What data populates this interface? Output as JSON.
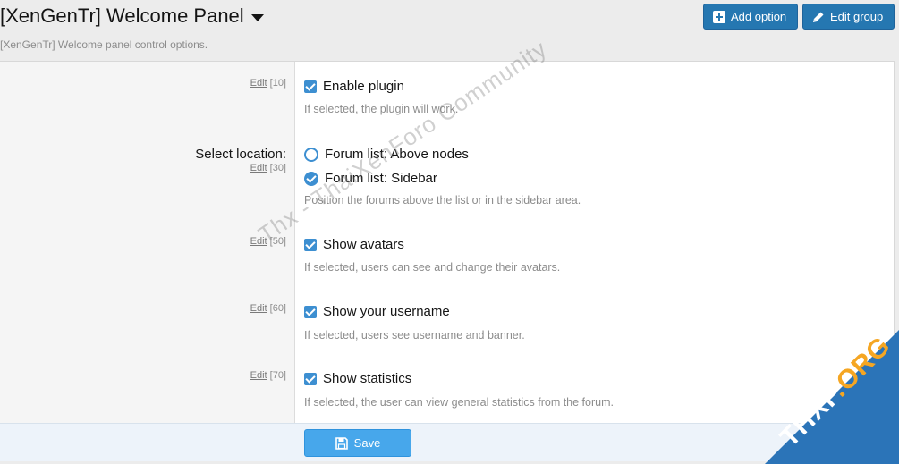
{
  "header": {
    "title": "[XenGenTr] Welcome Panel",
    "description": "[XenGenTr] Welcome panel control options."
  },
  "actions": {
    "add_option": "Add option",
    "edit_group": "Edit group"
  },
  "options": {
    "enable_plugin": {
      "edit": "Edit",
      "order": "[10]",
      "label": "Enable plugin",
      "checked": true,
      "hint": "If selected, the plugin will work."
    },
    "location": {
      "title": "Select location:",
      "edit": "Edit",
      "order": "[30]",
      "choices": [
        {
          "label": "Forum list: Above nodes",
          "selected": false
        },
        {
          "label": "Forum list: Sidebar",
          "selected": true
        }
      ],
      "hint": "Position the forums above the list or in the sidebar area."
    },
    "show_avatars": {
      "edit": "Edit",
      "order": "[50]",
      "label": "Show avatars",
      "checked": true,
      "hint": "If selected, users can see and change their avatars."
    },
    "show_username": {
      "edit": "Edit",
      "order": "[60]",
      "label": "Show your username",
      "checked": true,
      "hint": "If selected, users see username and banner."
    },
    "show_statistics": {
      "edit": "Edit",
      "order": "[70]",
      "label": "Show statistics",
      "checked": true,
      "hint": "If selected, the user can view general statistics from the forum."
    }
  },
  "footer": {
    "save_label": "Save"
  },
  "watermark": {
    "text": "Thx - ThaiXenForo Community",
    "corner_main": "THXF",
    "corner_suffix": ".ORG"
  },
  "colors": {
    "primary_button": "#2577b1",
    "save_button": "#47a7eb",
    "checkbox": "#3d8fd1"
  }
}
